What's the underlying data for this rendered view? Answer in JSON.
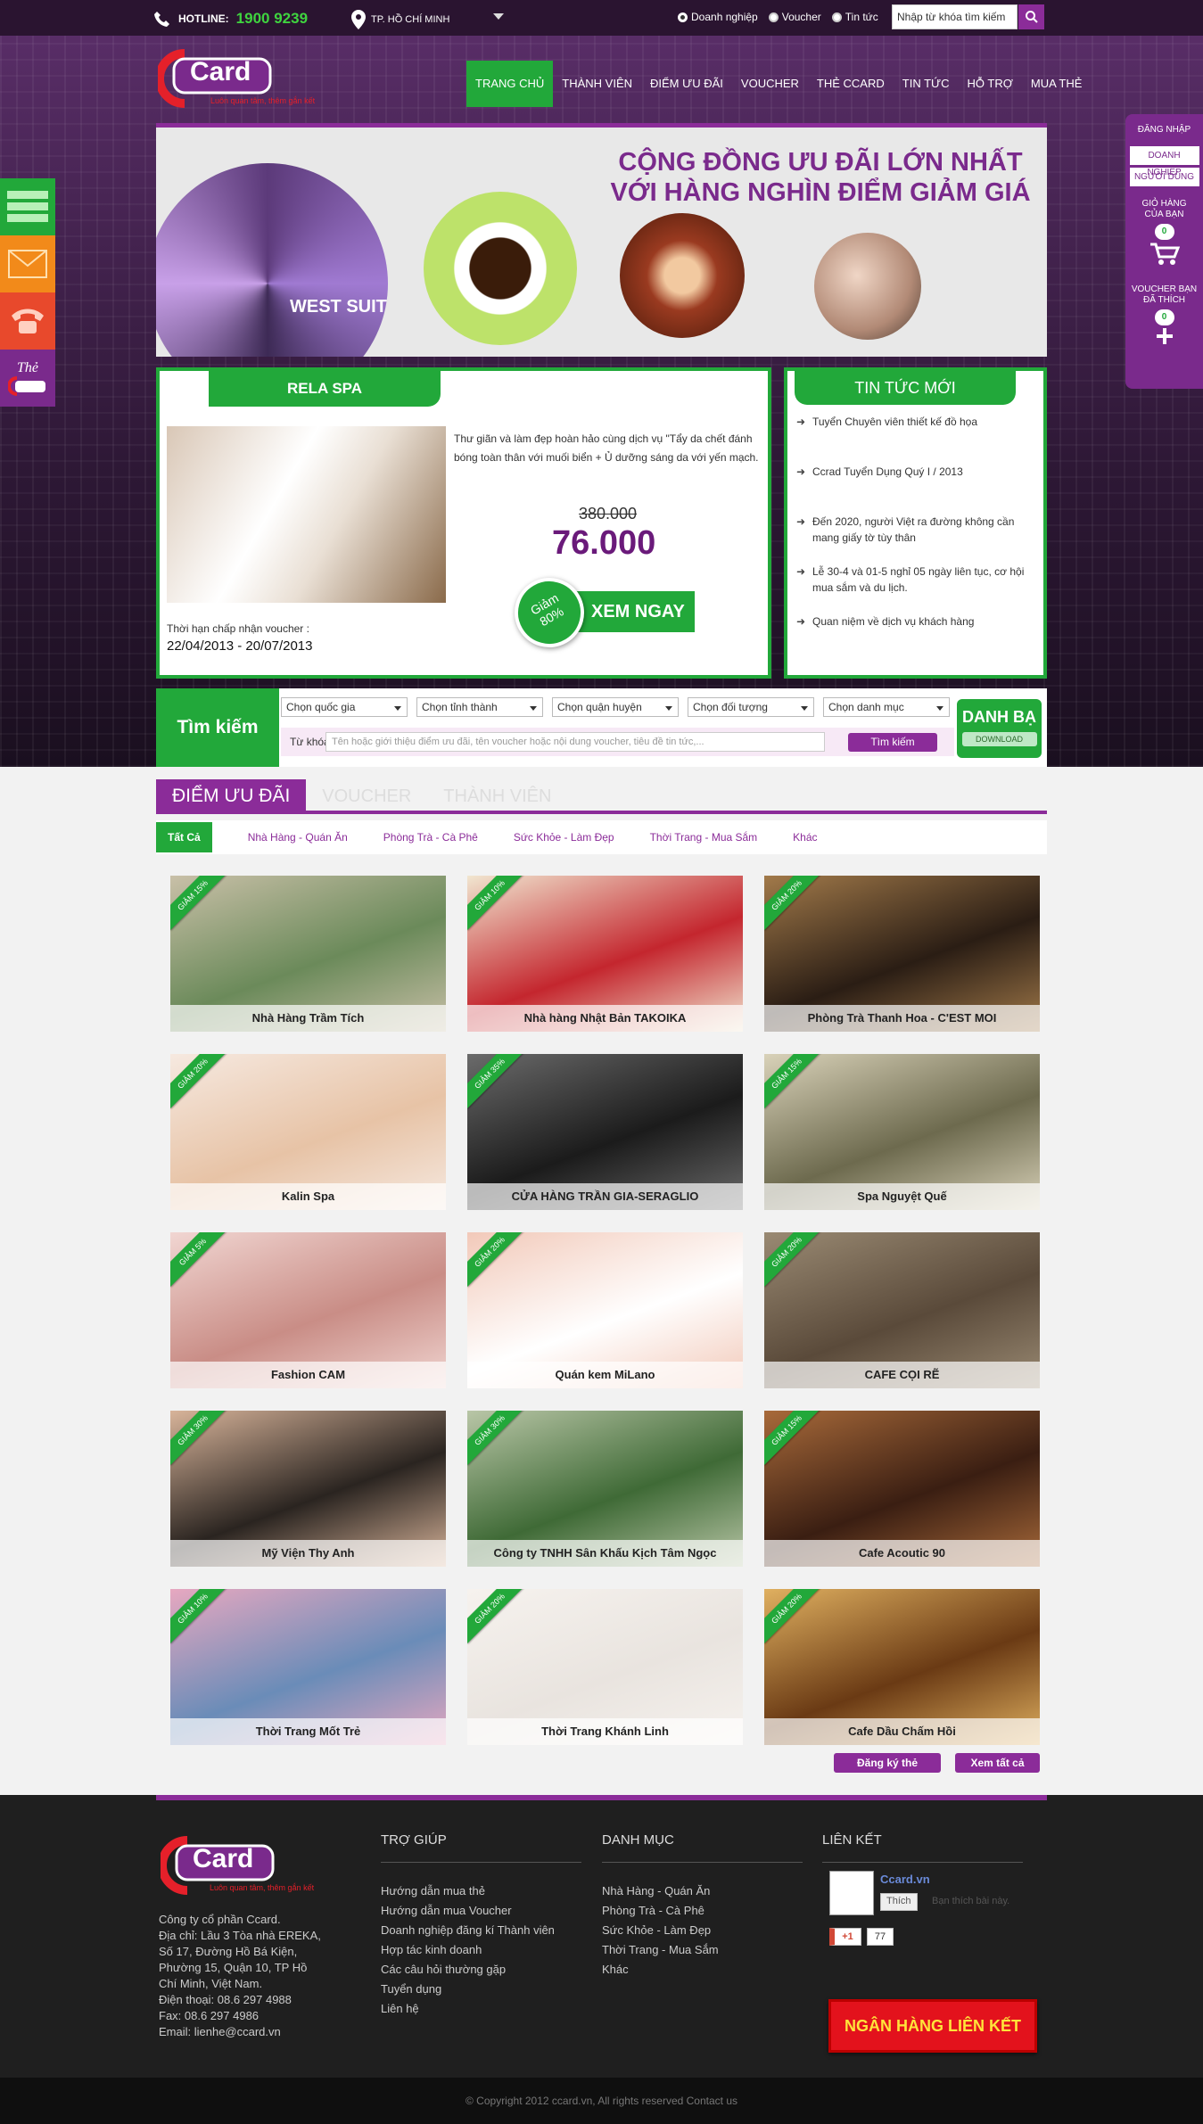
{
  "topbar": {
    "hotline_label": "HOTLINE:",
    "hotline_number": "1900 9239",
    "location": "TP. HỒ CHÍ MINH",
    "radio": [
      "Doanh nghiệp",
      "Voucher",
      "Tin tức"
    ],
    "search_placeholder": "Nhập từ khóa tìm kiếm"
  },
  "logo": {
    "name": "Card",
    "tagline": "Luôn quan tâm, thêm gắn kết"
  },
  "nav": [
    "TRANG CHỦ",
    "THÀNH VIÊN",
    "ĐIỂM ƯU ĐÃI",
    "VOUCHER",
    "THẺ CCARD",
    "TIN TỨC",
    "HỖ TRỢ",
    "MUA THẺ"
  ],
  "banner": {
    "line1": "CỘNG ĐỒNG ƯU ĐÃI LỚN NHẤT",
    "line2": "VỚI HÀNG NGHÌN ĐIỂM GIẢM GIÁ",
    "sign": "WEST SUIT"
  },
  "deal": {
    "title": "RELA SPA",
    "desc": "Thư giãn và làm đẹp hoàn hảo cùng dịch vụ \"Tẩy da chết đánh bóng toàn thân với muối biển + Ủ dưỡng sáng da với yến mạch.",
    "old_price": "380.000",
    "new_price": "76.000",
    "badge_line1": "Giảm",
    "badge_line2": "80%",
    "cta": "XEM NGAY",
    "deadline_label": "Thời hạn chấp nhận voucher :",
    "deadline": "22/04/2013 - 20/07/2013"
  },
  "news": {
    "title": "Tin tức mới",
    "items": [
      "Tuyển Chuyên viên thiết kế đồ họa",
      "Ccrad Tuyển Dụng Quý I / 2013",
      "Đến 2020, người Việt ra đường không cần mang giấy tờ tùy thân",
      "Lễ 30-4 và 01-5 nghỉ 05 ngày liên tục, cơ hội mua sắm và du lịch.",
      "Quan niệm về dịch vụ khách hàng"
    ]
  },
  "search": {
    "title": "Tìm kiếm",
    "selects": [
      "Chọn quốc gia",
      "Chọn tỉnh thành",
      "Chọn quận huyện",
      "Chọn đối tượng",
      "Chọn danh mục"
    ],
    "keyword_label": "Từ khóa:",
    "keyword_placeholder": "Tên hoặc giới thiệu điểm ưu đãi, tên voucher hoặc nội dung voucher, tiêu đề tin tức,...",
    "button": "Tìm kiếm",
    "dir_title": "DANH BẠ",
    "dir_sub": "DOWNLOAD"
  },
  "tabs": [
    "ĐIỂM ƯU ĐÃI",
    "VOUCHER",
    "THÀNH VIÊN"
  ],
  "cats": [
    "Tất Cả",
    "Nhà Hàng - Quán Ăn",
    "Phòng Trà - Cà Phê",
    "Sức Khỏe - Làm Đẹp",
    "Thời Trang - Mua Sắm",
    "Khác"
  ],
  "cards": [
    {
      "name": "Nhà Hàng Trầm Tích",
      "discount": "GIẢM 15%",
      "c1": "#6b8a5a",
      "c2": "#c9c0a8"
    },
    {
      "name": "Nhà hàng Nhật Bản TAKOIKA",
      "discount": "GIẢM 10%",
      "c1": "#c4262e",
      "c2": "#f1e6d0"
    },
    {
      "name": "Phòng Trà Thanh Hoa - C'EST MOI",
      "discount": "GIẢM 20%",
      "c1": "#2a1d14",
      "c2": "#a27a4a"
    },
    {
      "name": "Kalin Spa",
      "discount": "GIẢM 20%",
      "c1": "#e7c3a6",
      "c2": "#f6e9e0"
    },
    {
      "name": "CỬA HÀNG TRẦN GIA-SERAGLIO",
      "discount": "GIẢM 35%",
      "c1": "#1b1b1b",
      "c2": "#6b6b6b"
    },
    {
      "name": "Spa Nguyệt Quế",
      "discount": "GIẢM 15%",
      "c1": "#6d6a4e",
      "c2": "#d9d2b9"
    },
    {
      "name": "Fashion CAM",
      "discount": "GIẢM 5%",
      "c1": "#c98d86",
      "c2": "#f1d6d2"
    },
    {
      "name": "Quán kem MiLano",
      "discount": "GIẢM 20%",
      "c1": "#ffffff",
      "c2": "#f2c9b9"
    },
    {
      "name": "CAFE CỌI RẼ",
      "discount": "GIẢM 20%",
      "c1": "#5a4a3a",
      "c2": "#9a8a73"
    },
    {
      "name": "Mỹ Viện Thy Anh",
      "discount": "GIẢM 30%",
      "c1": "#2a2420",
      "c2": "#d8b49a"
    },
    {
      "name": "Công ty TNHH Sân Khấu Kịch Tâm Ngọc",
      "discount": "GIẢM 30%",
      "c1": "#3f6a36",
      "c2": "#b9c6a7"
    },
    {
      "name": "Cafe Acoutic 90",
      "discount": "GIẢM 15%",
      "c1": "#3a1e12",
      "c2": "#a86a3a"
    },
    {
      "name": "Thời Trang Mốt Trẻ",
      "discount": "GIẢM 10%",
      "c1": "#6a8cb8",
      "c2": "#e7a8c0"
    },
    {
      "name": "Thời Trang Khánh Linh",
      "discount": "GIẢM 20%",
      "c1": "#e9e4df",
      "c2": "#f6f2ee"
    },
    {
      "name": "Cafe Dầu Chấm Hồi",
      "discount": "GIẢM 20%",
      "c1": "#6a3a14",
      "c2": "#e0b060"
    }
  ],
  "actions": {
    "register": "Đăng ký thẻ",
    "view_all": "Xem tất cả"
  },
  "footer": {
    "company": [
      "Công ty cổ phần Ccard.",
      "Địa chỉ: Lầu 3 Tòa nhà EREKA,",
      "Số 17, Đường Hồ Bá Kiện,",
      "Phường 15, Quận 10, TP Hồ",
      "Chí Minh, Việt Nam.",
      "Điện thoại: 08.6 297 4988",
      "Fax: 08.6 297 4986",
      "Email: lienhe@ccard.vn"
    ],
    "help_title": "TRỢ GIÚP",
    "help": [
      "Hướng dẫn mua thẻ",
      "Hướng dẫn mua Voucher",
      "Doanh nghiệp đăng kí Thành viên",
      "Hợp tác kinh doanh",
      "Các câu hỏi thường gặp",
      "Tuyển dụng",
      "Liên hệ"
    ],
    "cat_title": "DANH MỤC",
    "cats": [
      "Nhà Hàng - Quán Ăn",
      "Phòng Trà - Cà Phê",
      "Sức Khỏe - Làm Đẹp",
      "Thời Trang - Mua Sắm",
      "Khác"
    ],
    "link_title": "LIÊN KẾT",
    "fb_name": "Ccard.vn",
    "like": "Thích",
    "like_text": "Bạn thích bài này.",
    "gplus": "+1",
    "gcount": "77",
    "bank": "NGÂN HÀNG LIÊN KẾT",
    "copyright": "© Copyright 2012 ccard.vn, All rights reserved Contact us"
  },
  "right": {
    "login": "ĐĂNG NHẬP",
    "biz": "DOANH NGHIỆP",
    "user": "NGƯỜI DÙNG",
    "cart": "GIỎ HÀNG CỦA BẠN",
    "cart_count": "0",
    "liked": "VOUCHER BẠN ĐÃ THÍCH",
    "liked_count": "0"
  },
  "side": {
    "card": "Thẻ"
  }
}
